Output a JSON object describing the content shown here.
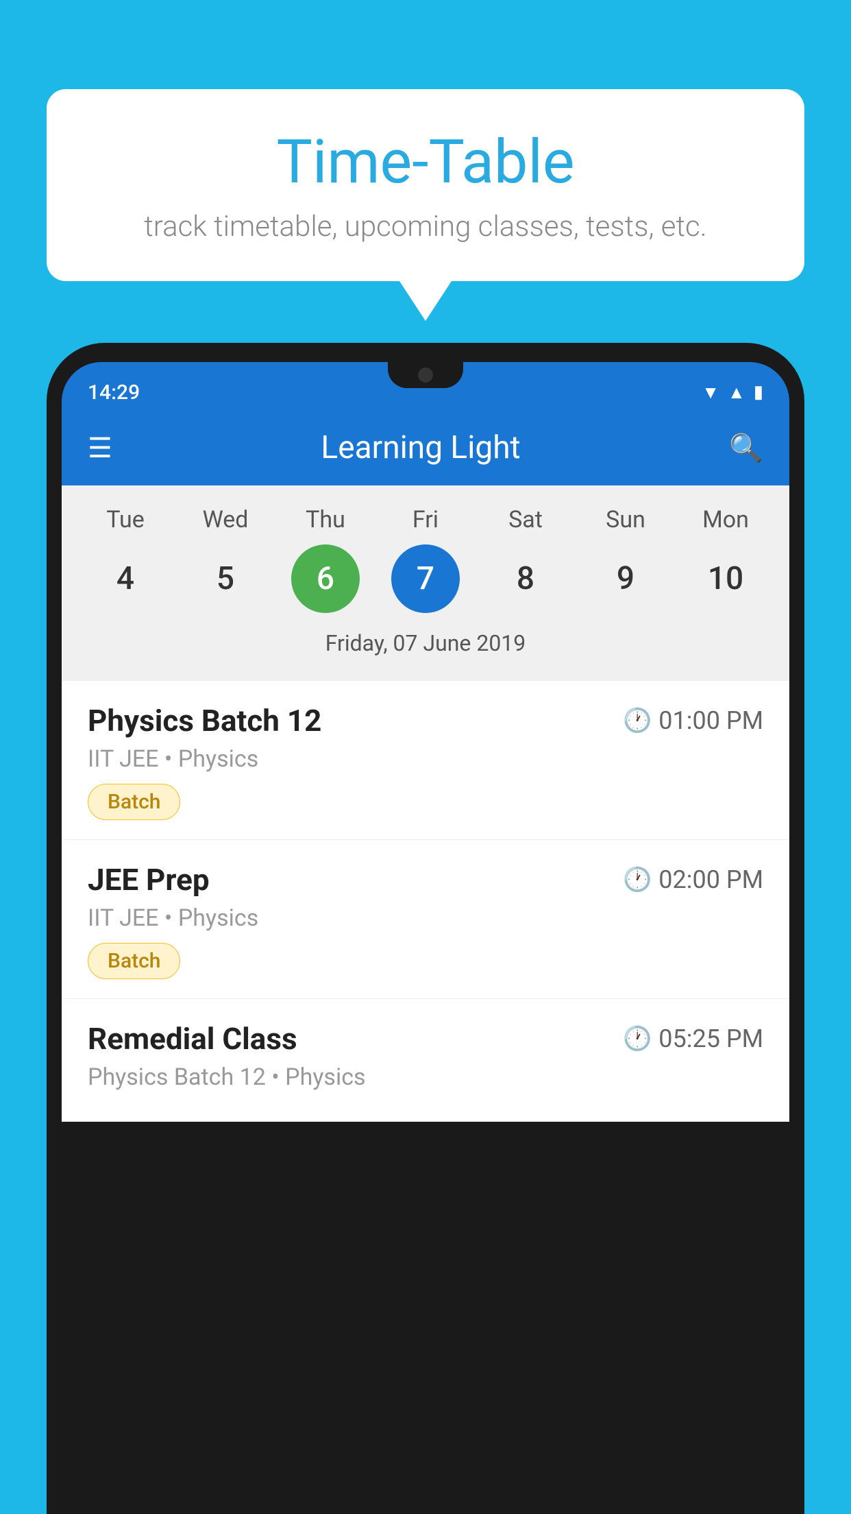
{
  "header": {
    "title": "Time-Table",
    "subtitle": "track timetable, upcoming classes, tests, etc."
  },
  "app": {
    "name": "Learning Light",
    "time": "14:29"
  },
  "calendar": {
    "selected_date_label": "Friday, 07 June 2019",
    "days": [
      "Tue",
      "Wed",
      "Thu",
      "Fri",
      "Sat",
      "Sun",
      "Mon"
    ],
    "dates": [
      "4",
      "5",
      "6",
      "7",
      "8",
      "9",
      "10"
    ],
    "today_index": 2,
    "selected_index": 3
  },
  "schedule": [
    {
      "title": "Physics Batch 12",
      "time": "01:00 PM",
      "subtitle": "IIT JEE • Physics",
      "badge": "Batch"
    },
    {
      "title": "JEE Prep",
      "time": "02:00 PM",
      "subtitle": "IIT JEE • Physics",
      "badge": "Batch"
    },
    {
      "title": "Remedial Class",
      "time": "05:25 PM",
      "subtitle": "Physics Batch 12 • Physics",
      "badge": ""
    }
  ],
  "icons": {
    "hamburger": "≡",
    "search": "🔍",
    "clock": "🕐"
  }
}
